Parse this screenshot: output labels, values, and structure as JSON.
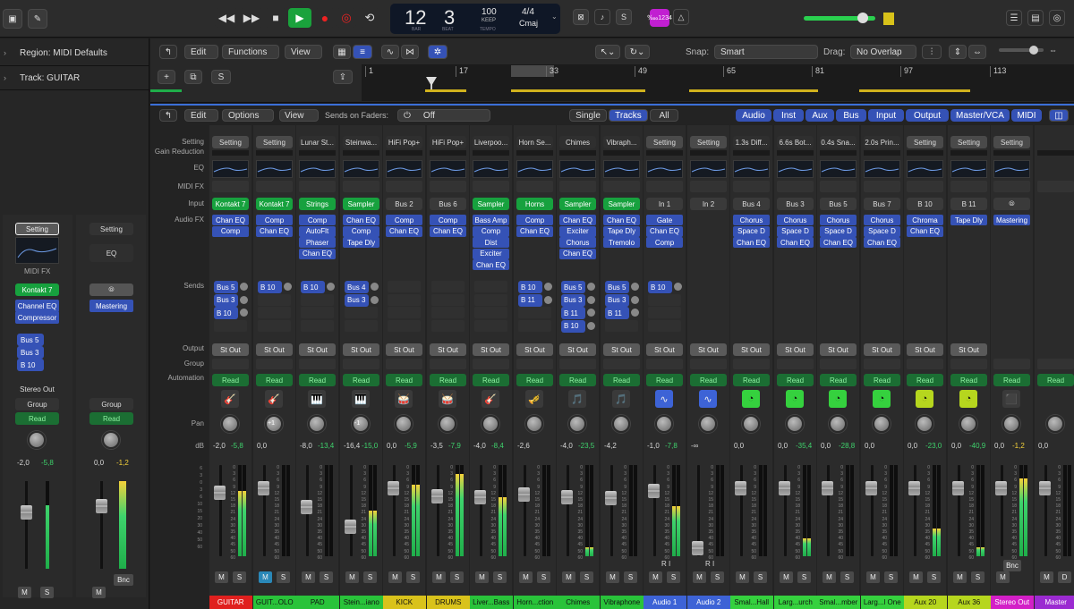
{
  "transport": {
    "bar": "12",
    "beat": "3",
    "bar_label": "BAR",
    "beat_label": "BEAT",
    "tempo": "100",
    "tempo_sub": "KEEP",
    "tempo_label": "TEMPO",
    "sig": "4/4",
    "key": "Cmaj",
    "lcd_mode": "‱1234"
  },
  "inspector": {
    "region": "Region: MIDI Defaults",
    "track": "Track: GUITAR"
  },
  "editor": {
    "edit": "Edit",
    "functions": "Functions",
    "view": "View",
    "snap_label": "Snap:",
    "snap": "Smart",
    "drag_label": "Drag:",
    "drag": "No Overlap",
    "s": "S",
    "rulers": [
      "1",
      "17",
      "33",
      "49",
      "65",
      "81",
      "97",
      "113"
    ]
  },
  "mixer": {
    "edit": "Edit",
    "options": "Options",
    "view": "View",
    "sends_on_faders": "Sends on Faders:",
    "sends_val": "Off",
    "single": "Single",
    "tracks": "Tracks",
    "all": "All",
    "filters": [
      "Audio",
      "Inst",
      "Aux",
      "Bus",
      "Input",
      "Output",
      "Master/VCA",
      "MIDI"
    ],
    "row_labels": {
      "setting": "Setting",
      "gain": "Gain Reduction",
      "eq": "EQ",
      "midifx": "MIDI FX",
      "input": "Input",
      "audiofx": "Audio FX",
      "sends": "Sends",
      "output": "Output",
      "group": "Group",
      "automation": "Automation",
      "pan": "Pan",
      "db": "dB"
    }
  },
  "left_strips": {
    "a": {
      "setting": "Setting",
      "midifx": "MIDI FX",
      "input": "Kontakt 7",
      "fx": [
        "Channel EQ",
        "Compressor"
      ],
      "sends": [
        "Bus 5",
        "Bus 3",
        "B 10"
      ],
      "output": "Stereo Out",
      "group": "Group",
      "auto": "Read",
      "db1": "-2,0",
      "db2": "-5,8",
      "m": "M",
      "s": "S"
    },
    "b": {
      "setting": "Setting",
      "eq": "EQ",
      "input": "⦾",
      "fx": [
        "Mastering"
      ],
      "group": "Group",
      "auto": "Read",
      "db1": "0,0",
      "db2": "-1,2",
      "bnc": "Bnc",
      "m": "M"
    }
  },
  "channels": [
    {
      "name": "GUITAR",
      "color": "#e0201e",
      "setting": "Setting",
      "input": "Kontakt 7",
      "inkind": "grn",
      "fx": [
        "Chan EQ",
        "Comp"
      ],
      "sends": [
        "Bus 5",
        "Bus 3",
        "B 10"
      ],
      "out": "St Out",
      "icon": "🎸",
      "pan": "",
      "db1": "-2,0",
      "db2": "-5,8",
      "lvl": 0.72,
      "m": "M",
      "s": "S"
    },
    {
      "name": "GUIT...OLO",
      "color": "#29c33a",
      "setting": "Setting",
      "input": "Kontakt 7",
      "inkind": "grn",
      "fx": [
        "Comp",
        "Chan EQ"
      ],
      "sends": [
        "B 10"
      ],
      "out": "St Out",
      "icon": "🎸",
      "pan": "+1",
      "db1": "0,0",
      "db2": "",
      "lvl": 0,
      "m": "M",
      "s": "S"
    },
    {
      "name": "PAD",
      "color": "#29c33a",
      "setting": "Lunar St...",
      "input": "Strings",
      "inkind": "grn",
      "fx": [
        "Comp",
        "AutoFlt",
        "Phaser",
        "Chan EQ"
      ],
      "sends": [
        "B 10"
      ],
      "out": "St Out",
      "icon": "🎹",
      "pan": "",
      "db1": "-8,0",
      "db2": "-13,4",
      "lvl": 0,
      "m": "M",
      "s": "S"
    },
    {
      "name": "Stein...iano",
      "color": "#29c33a",
      "setting": "Steinwa...",
      "input": "Sampler",
      "inkind": "grn",
      "fx": [
        "Chan EQ",
        "Comp",
        "Tape Dly"
      ],
      "sends": [
        "Bus 4",
        "Bus 3"
      ],
      "out": "St Out",
      "icon": "🎹",
      "pan": "-1",
      "db1": "-16,4",
      "db2": "-15,0",
      "lvl": 0.5,
      "m": "M",
      "s": "S"
    },
    {
      "name": "KICK",
      "color": "#d9c21b",
      "setting": "HiFi Pop+",
      "input": "Bus 2",
      "inkind": "in",
      "fx": [
        "Comp",
        "Chan EQ"
      ],
      "sends": [],
      "out": "St Out",
      "icon": "🥁",
      "pan": "",
      "db1": "0,0",
      "db2": "-5,9",
      "lvl": 0.78,
      "m": "M",
      "s": "S"
    },
    {
      "name": "DRUMS",
      "color": "#d9c21b",
      "setting": "HiFi Pop+",
      "input": "Bus 6",
      "inkind": "in",
      "fx": [
        "Comp",
        "Chan EQ"
      ],
      "sends": [],
      "out": "St Out",
      "icon": "🥁",
      "pan": "",
      "db1": "-3,5",
      "db2": "-7,9",
      "lvl": 0.9,
      "m": "M",
      "s": "S"
    },
    {
      "name": "Liver...Bass",
      "color": "#29c33a",
      "setting": "Liverpoo...",
      "input": "Sampler",
      "inkind": "grn",
      "fx": [
        "Bass Amp",
        "Comp",
        "Dist",
        "Exciter",
        "Chan EQ"
      ],
      "sends": [],
      "out": "St Out",
      "icon": "🎸",
      "pan": "",
      "db1": "-4,0",
      "db2": "-8,4",
      "lvl": 0.65,
      "m": "M",
      "s": "S"
    },
    {
      "name": "Horn...ction",
      "color": "#29c33a",
      "setting": "Horn Se...",
      "input": "Horns",
      "inkind": "grn",
      "fx": [
        "Comp",
        "Chan EQ"
      ],
      "sends": [
        "B 10",
        "B 11"
      ],
      "out": "St Out",
      "icon": "🎺",
      "pan": "",
      "db1": "-2,6",
      "db2": "",
      "lvl": 0,
      "m": "M",
      "s": "S"
    },
    {
      "name": "Chimes",
      "color": "#29c33a",
      "setting": "Chimes",
      "input": "Sampler",
      "inkind": "grn",
      "fx": [
        "Chan EQ",
        "Exciter",
        "Chorus",
        "Chan EQ"
      ],
      "sends": [
        "Bus 5",
        "Bus 3",
        "B 11",
        "B 10"
      ],
      "out": "St Out",
      "icon": "🎵",
      "pan": "",
      "db1": "-4,0",
      "db2": "-23,5",
      "lvl": 0.1,
      "m": "M",
      "s": "S"
    },
    {
      "name": "Vibraphone",
      "color": "#29c33a",
      "setting": "Vibraph...",
      "input": "Sampler",
      "inkind": "grn",
      "fx": [
        "Chan EQ",
        "Tape Dly",
        "Tremolo"
      ],
      "sends": [
        "Bus 5",
        "Bus 3",
        "B 11"
      ],
      "out": "St Out",
      "icon": "🎵",
      "pan": "",
      "db1": "-4,2",
      "db2": "",
      "lvl": 0,
      "m": "M",
      "s": "S"
    },
    {
      "name": "Audio 1",
      "color": "#3d63d6",
      "setting": "Setting",
      "input": "In 1",
      "inkind": "in",
      "fx": [
        "Gate",
        "Chan EQ",
        "Comp"
      ],
      "sends": [
        "B 10"
      ],
      "out": "St Out",
      "icon": "∿",
      "pan": "",
      "db1": "-1,0",
      "db2": "-7,8",
      "lvl": 0.55,
      "m": "M",
      "s": "S",
      "ri": "R I"
    },
    {
      "name": "Audio 2",
      "color": "#3d63d6",
      "setting": "Setting",
      "input": "In 2",
      "inkind": "in",
      "fx": [],
      "sends": [],
      "out": "St Out",
      "icon": "∿",
      "pan": "",
      "db1": "-∞",
      "db2": "",
      "lvl": 0,
      "m": "M",
      "s": "S",
      "ri": "R I"
    },
    {
      "name": "Smal...Hall",
      "color": "#35d13e",
      "setting": "1.3s Diff...",
      "input": "Bus 4",
      "inkind": "in",
      "fx": [
        "Chorus",
        "Space D",
        "Chan EQ"
      ],
      "sends": [],
      "out": "St Out",
      "icon": "◔",
      "pan": "",
      "db1": "0,0",
      "db2": "",
      "lvl": 0,
      "m": "M",
      "s": "S"
    },
    {
      "name": "Larg...urch",
      "color": "#35d13e",
      "setting": "6.6s Bot...",
      "input": "Bus 3",
      "inkind": "in",
      "fx": [
        "Chorus",
        "Space D",
        "Chan EQ"
      ],
      "sends": [],
      "out": "St Out",
      "icon": "◔",
      "pan": "",
      "db1": "0,0",
      "db2": "-35,4",
      "lvl": 0.2,
      "m": "M",
      "s": "S"
    },
    {
      "name": "Smal...mber",
      "color": "#35d13e",
      "setting": "0.4s Sna...",
      "input": "Bus 5",
      "inkind": "in",
      "fx": [
        "Chorus",
        "Space D",
        "Chan EQ"
      ],
      "sends": [],
      "out": "St Out",
      "icon": "◔",
      "pan": "",
      "db1": "0,0",
      "db2": "-28,8",
      "lvl": 0,
      "m": "M",
      "s": "S"
    },
    {
      "name": "Larg...l One",
      "color": "#35d13e",
      "setting": "2.0s Prin...",
      "input": "Bus 7",
      "inkind": "in",
      "fx": [
        "Chorus",
        "Space D",
        "Chan EQ"
      ],
      "sends": [],
      "out": "St Out",
      "icon": "◔",
      "pan": "",
      "db1": "0,0",
      "db2": "",
      "lvl": 0,
      "m": "M",
      "s": "S"
    },
    {
      "name": "Aux 20",
      "color": "#b6d61e",
      "setting": "Setting",
      "input": "B 10",
      "inkind": "in",
      "fx": [
        "Chroma",
        "Chan EQ"
      ],
      "sends": [],
      "out": "St Out",
      "icon": "◔",
      "pan": "",
      "db1": "0,0",
      "db2": "-23,0",
      "lvl": 0.3,
      "m": "M",
      "s": "S"
    },
    {
      "name": "Aux 36",
      "color": "#b6d61e",
      "setting": "Setting",
      "input": "B 11",
      "inkind": "in",
      "fx": [
        "Tape Dly"
      ],
      "sends": [],
      "out": "St Out",
      "icon": "◔",
      "pan": "",
      "db1": "0,0",
      "db2": "-40,9",
      "lvl": 0.1,
      "m": "M",
      "s": "S"
    },
    {
      "name": "Stereo Out",
      "color": "#d31fc7",
      "setting": "Setting",
      "input": "⦾",
      "inkind": "in",
      "fx": [
        "Mastering"
      ],
      "sends": [],
      "out": "",
      "icon": "⬛",
      "pan": "",
      "db1": "0,0",
      "db2": "-1,2",
      "lvl": 0.85,
      "m": "M",
      "s": "",
      "bnc": "Bnc"
    },
    {
      "name": "Master",
      "color": "#9b2ad1",
      "setting": "",
      "input": "",
      "inkind": "in",
      "fx": [],
      "sends": [],
      "out": "",
      "icon": "",
      "pan": "",
      "db1": "0,0",
      "db2": "",
      "lvl": 0,
      "m": "M",
      "s": "D",
      "auto": "Read"
    }
  ],
  "colors": {
    "bg": "#1e1e1e",
    "accent": "#3552b6",
    "green": "#17a13e"
  }
}
